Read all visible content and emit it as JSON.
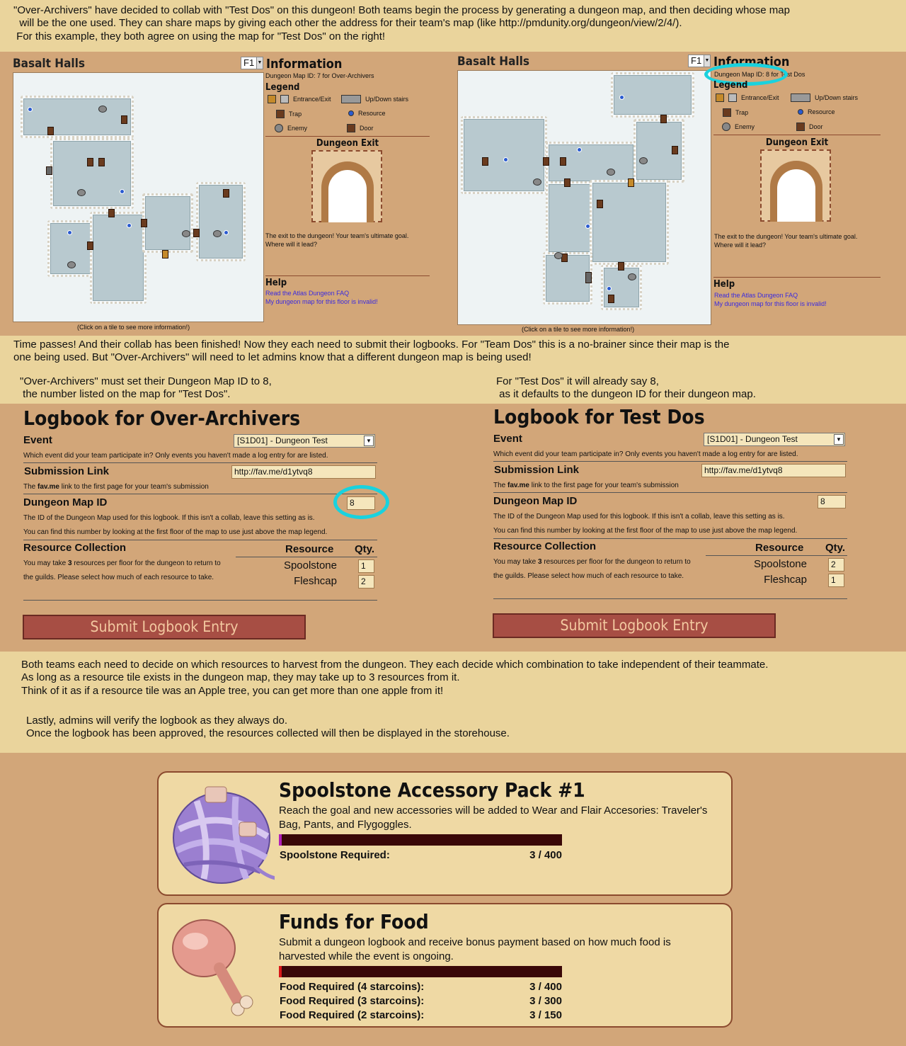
{
  "intro": {
    "line1": "\"Over-Archivers\" have decided to collab with \"Test Dos\" on this dungeon! Both teams begin the process by generating a dungeon map, and then deciding whose map",
    "line2": "  will be the one used. They can share maps by giving each other the address for their team's map (like http://pmdunity.org/dungeon/view/2/4/).",
    "line3": " For this example, they both agree on using the map for \"Test Dos\" on the right!"
  },
  "maps": [
    {
      "title": "Basalt Halls",
      "floor": "F1",
      "info_heading": "Information",
      "map_id_line": "Dungeon Map ID: 7 for Over-Archivers",
      "legend_heading": "Legend",
      "legend": [
        "Entrance/Exit",
        "Up/Down stairs",
        "Trap",
        "Resource",
        "Enemy",
        "Door"
      ],
      "exit_heading": "Dungeon Exit",
      "exit_text1": "The exit to the dungeon! Your team's ultimate goal.",
      "exit_text2": "Where will it lead?",
      "help_heading": "Help",
      "help_link1": "Read the Atlas Dungeon FAQ",
      "help_link2": "My dungeon map for this floor is invalid!",
      "caption": "(Click on a tile to see more information!)"
    },
    {
      "title": "Basalt Halls",
      "floor": "F1",
      "info_heading": "Information",
      "map_id_line": "Dungeon Map ID: 8 for Test Dos",
      "legend_heading": "Legend",
      "legend": [
        "Entrance/Exit",
        "Up/Down stairs",
        "Trap",
        "Resource",
        "Enemy",
        "Door"
      ],
      "exit_heading": "Dungeon Exit",
      "exit_text1": "The exit to the dungeon! Your team's ultimate goal.",
      "exit_text2": "Where will it lead?",
      "help_heading": "Help",
      "help_link1": "Read the Atlas Dungeon FAQ",
      "help_link2": "My dungeon map for this floor is invalid!",
      "caption": "(Click on a tile to see more information!)"
    }
  ],
  "mid": {
    "line1": "Time passes! And their collab has been finished! Now they each need to submit their logbooks. For \"Team Dos\" this is a no-brainer since their map is the",
    "line2": "one being used. But \"Over-Archivers\" will need to let admins know that a different dungeon map is being used!",
    "left1": "\"Over-Archivers\" must set their Dungeon Map ID to 8,",
    "left2": " the number listed on the map for \"Test Dos\".",
    "right1": "For \"Test Dos\" it will already say 8,",
    "right2": " as it defaults to the dungeon ID for their dungeon map."
  },
  "logbooks": [
    {
      "title": "Logbook for Over-Archivers",
      "event_label": "Event",
      "event_value": "[S1D01] - Dungeon Test",
      "event_desc": "Which event did your team participate in? Only events you haven't made a log entry for are listed.",
      "link_label": "Submission Link",
      "link_value": "http://fav.me/d1ytvq8",
      "link_desc_bold": "fav.me",
      "link_desc_pre": "The ",
      "link_desc_post": " link to the first page for your team's submission",
      "map_label": "Dungeon Map ID",
      "map_value": "8",
      "map_desc1": "The ID of the Dungeon Map used for this logbook. If this isn't a collab, leave this setting as is.",
      "map_desc2": "You can find this number by looking at the first floor of the map to use just above the map legend.",
      "res_label": "Resource Collection",
      "res_col": "Resource",
      "qty_col": "Qty.",
      "res_desc_pre": "You may take ",
      "res_desc_bold": "3",
      "res_desc_post": " resources per floor for the dungeon to return to the guilds. Please select how much of each resource to take.",
      "resources": [
        {
          "name": "Spoolstone",
          "qty": "1"
        },
        {
          "name": "Fleshcap",
          "qty": "2"
        }
      ],
      "submit": "Submit Logbook Entry"
    },
    {
      "title": "Logbook for Test Dos",
      "event_label": "Event",
      "event_value": "[S1D01] - Dungeon Test",
      "event_desc": "Which event did your team participate in? Only events you haven't made a log entry for are listed.",
      "link_label": "Submission Link",
      "link_value": "http://fav.me/d1ytvq8",
      "link_desc_bold": "fav.me",
      "link_desc_pre": "The ",
      "link_desc_post": " link to the first page for your team's submission",
      "map_label": "Dungeon Map ID",
      "map_value": "8",
      "map_desc1": "The ID of the Dungeon Map used for this logbook. If this isn't a collab, leave this setting as is.",
      "map_desc2": "You can find this number by looking at the first floor of the map to use just above the map legend.",
      "res_label": "Resource Collection",
      "res_col": "Resource",
      "qty_col": "Qty.",
      "res_desc_pre": "You may take ",
      "res_desc_bold": "3",
      "res_desc_post": " resources per floor for the dungeon to return to the guilds. Please select how much of each resource to take.",
      "resources": [
        {
          "name": "Spoolstone",
          "qty": "2"
        },
        {
          "name": "Fleshcap",
          "qty": "1"
        }
      ],
      "submit": "Submit Logbook Entry"
    }
  ],
  "outro": {
    "line1": "Both teams each need to decide on which resources to harvest from the dungeon. They each decide which combination to take independent of their teammate.",
    "line2": "As long as a resource tile exists in the dungeon map, they may take up to 3 resources from it.",
    "line3": "Think of it as if a resource tile was an Apple tree, you can get more than one apple from it!",
    "line4": "Lastly, admins will verify the logbook as they always do.",
    "line5": "Once the logbook has been approved, the resources collected will then be displayed in the storehouse."
  },
  "cards": [
    {
      "title": "Spoolstone Accessory Pack #1",
      "desc": "Reach the goal and new accessories will be added to Wear and Flair Accesories: Traveler's Bag, Pants, and Flygoggles.",
      "progress": 0.0075,
      "bar_color": "#b01fb8",
      "reqs": [
        {
          "label": "Spoolstone Required:",
          "value": "3 / 400"
        }
      ]
    },
    {
      "title": "Funds for Food",
      "desc": "Submit a dungeon logbook and receive bonus payment based on how much food is harvested while the event is ongoing.",
      "progress": 0.0075,
      "bar_color": "#d81818",
      "reqs": [
        {
          "label": "Food Required (4 starcoins):",
          "value": "3 / 400"
        },
        {
          "label": "Food Required (3 starcoins):",
          "value": "3 / 300"
        },
        {
          "label": "Food Required (2 starcoins):",
          "value": "3 / 150"
        }
      ]
    }
  ]
}
